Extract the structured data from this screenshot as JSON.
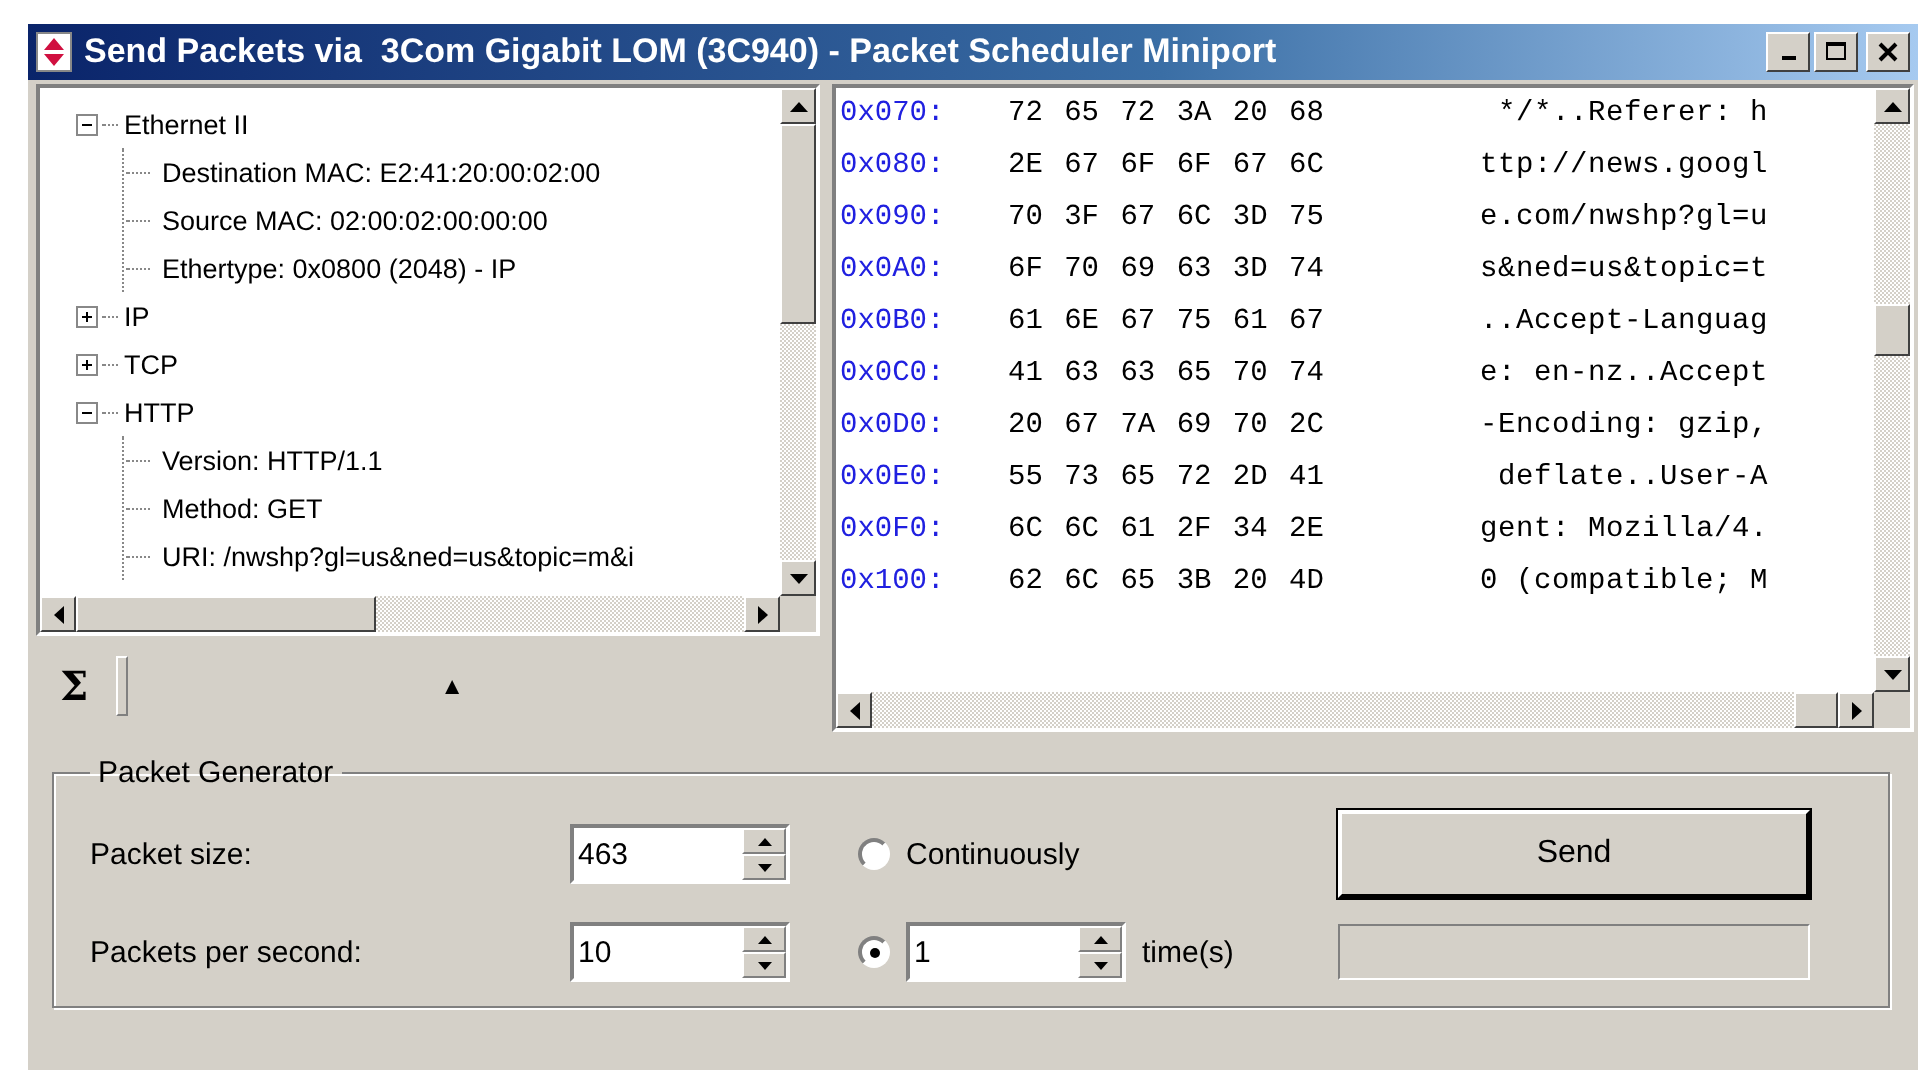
{
  "window": {
    "title": "Send Packets via  3Com Gigabit LOM (3C940) - Packet Scheduler Miniport"
  },
  "tree": [
    {
      "label": "Ethernet II",
      "expanded": true,
      "children": [
        {
          "label": "Destination MAC: E2:41:20:00:02:00"
        },
        {
          "label": "Source MAC: 02:00:02:00:00:00"
        },
        {
          "label": "Ethertype: 0x0800 (2048) - IP"
        }
      ]
    },
    {
      "label": "IP",
      "expanded": false
    },
    {
      "label": "TCP",
      "expanded": false
    },
    {
      "label": "HTTP",
      "expanded": true,
      "children": [
        {
          "label": "Version: HTTP/1.1"
        },
        {
          "label": "Method: GET"
        },
        {
          "label": "URI: /nwshp?gl=us&ned=us&topic=m&i"
        }
      ]
    }
  ],
  "summary_bar": {
    "symbol": "Σ",
    "arrow": "▲"
  },
  "hex_rows": [
    {
      "offset": "0x070:",
      "bytes": "72 65 72 3A 20 68",
      "ascii": " */*..Referer: h"
    },
    {
      "offset": "0x080:",
      "bytes": "2E 67 6F 6F 67 6C",
      "ascii": "ttp://news.googl"
    },
    {
      "offset": "0x090:",
      "bytes": "70 3F 67 6C 3D 75",
      "ascii": "e.com/nwshp?gl=u"
    },
    {
      "offset": "0x0A0:",
      "bytes": "6F 70 69 63 3D 74",
      "ascii": "s&ned=us&topic=t"
    },
    {
      "offset": "0x0B0:",
      "bytes": "61 6E 67 75 61 67",
      "ascii": "..Accept-Languag"
    },
    {
      "offset": "0x0C0:",
      "bytes": "41 63 63 65 70 74",
      "ascii": "e: en-nz..Accept"
    },
    {
      "offset": "0x0D0:",
      "bytes": "20 67 7A 69 70 2C",
      "ascii": "-Encoding: gzip,"
    },
    {
      "offset": "0x0E0:",
      "bytes": "55 73 65 72 2D 41",
      "ascii": " deflate..User-A"
    },
    {
      "offset": "0x0F0:",
      "bytes": "6C 6C 61 2F 34 2E",
      "ascii": "gent: Mozilla/4."
    },
    {
      "offset": "0x100:",
      "bytes": "62 6C 65 3B 20 4D",
      "ascii": "0 (compatible; M"
    }
  ],
  "packet_generator": {
    "title": "Packet Generator",
    "packet_size": {
      "label": "Packet size:",
      "value": "463"
    },
    "packets_per_second": {
      "label": "Packets per second:",
      "value": "10"
    },
    "modes": [
      {
        "kind": "continuous",
        "label": "Continuously",
        "selected": false
      },
      {
        "kind": "count",
        "count": "1",
        "unit": "time(s)",
        "selected": true
      }
    ],
    "send_button": "Send",
    "progress": {
      "level": 0
    }
  }
}
